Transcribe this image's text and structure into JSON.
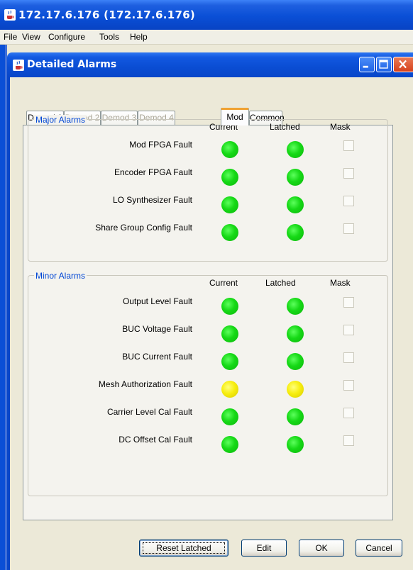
{
  "window": {
    "title": "172.17.6.176 (172.17.6.176)",
    "menu": [
      "File",
      "View",
      "Configure",
      "Tools",
      "Help"
    ]
  },
  "dialog": {
    "title": "Detailed Alarms",
    "tabs": [
      {
        "label": "Demod 1",
        "state": "enabled"
      },
      {
        "label": "Demod 2",
        "state": "disabled"
      },
      {
        "label": "Demod 3",
        "state": "disabled"
      },
      {
        "label": "Demod 4",
        "state": "disabled"
      },
      {
        "label": "Mod",
        "state": "selected"
      },
      {
        "label": "Common",
        "state": "enabled"
      }
    ],
    "columns": {
      "current": "Current",
      "latched": "Latched",
      "mask": "Mask"
    },
    "major": {
      "title": "Major Alarms",
      "rows": [
        {
          "label": "Mod FPGA Fault",
          "current": "green",
          "latched": "green",
          "mask": false
        },
        {
          "label": "Encoder FPGA Fault",
          "current": "green",
          "latched": "green",
          "mask": false
        },
        {
          "label": "LO Synthesizer Fault",
          "current": "green",
          "latched": "green",
          "mask": false
        },
        {
          "label": "Share Group Config Fault",
          "current": "green",
          "latched": "green",
          "mask": false
        }
      ]
    },
    "minor": {
      "title": "Minor Alarms",
      "rows": [
        {
          "label": "Output Level Fault",
          "current": "green",
          "latched": "green",
          "mask": false
        },
        {
          "label": "BUC Voltage Fault",
          "current": "green",
          "latched": "green",
          "mask": false
        },
        {
          "label": "BUC Current Fault",
          "current": "green",
          "latched": "green",
          "mask": false
        },
        {
          "label": "Mesh Authorization Fault",
          "current": "yellow",
          "latched": "yellow",
          "mask": false
        },
        {
          "label": "Carrier Level Cal Fault",
          "current": "green",
          "latched": "green",
          "mask": false
        },
        {
          "label": "DC Offset Cal Fault",
          "current": "green",
          "latched": "green",
          "mask": false
        }
      ]
    },
    "buttons": {
      "reset": "Reset Latched",
      "edit": "Edit",
      "ok": "OK",
      "cancel": "Cancel"
    }
  },
  "colors": {
    "titlebar": "#0a4fd6",
    "group_title": "#0046d5",
    "led_green": "#16d916",
    "led_yellow": "#f7ee10",
    "tab_accent": "#f0a232"
  },
  "icons": {
    "app": "java-cup-icon",
    "minimize": "minimize-icon",
    "maximize": "maximize-icon",
    "close": "close-icon"
  }
}
